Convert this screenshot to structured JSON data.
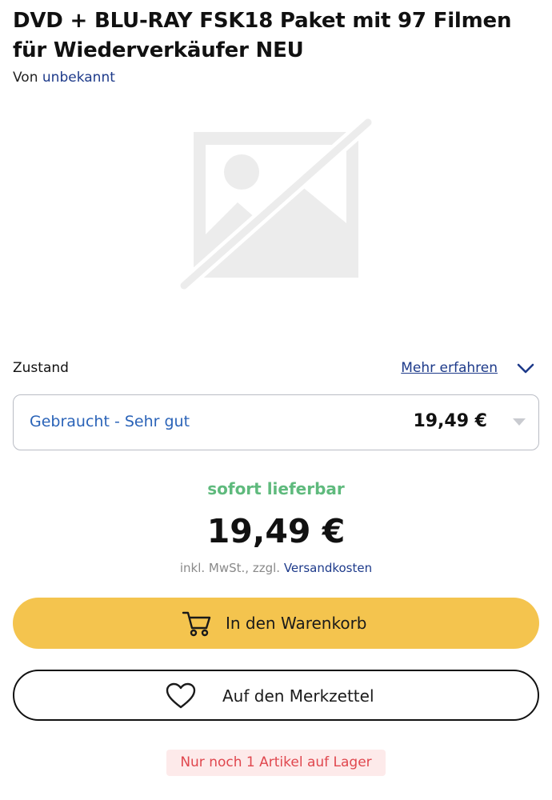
{
  "product": {
    "title": "DVD + BLU-RAY FSK18 Paket mit 97 Filmen für Wiederverkäufer NEU",
    "by_prefix": "Von",
    "by_name": "unbekannt",
    "image_icon": "image-placeholder-icon"
  },
  "condition": {
    "label": "Zustand",
    "more_link": "Mehr erfahren",
    "selected": "Gebraucht - Sehr gut",
    "price": "19,49 €"
  },
  "offer": {
    "availability": "sofort lieferbar",
    "price": "19,49 €",
    "tax_prefix": "inkl. MwSt., zzgl.",
    "shipping_link": "Versandkosten"
  },
  "actions": {
    "add_to_cart": "In den Warenkorb",
    "add_to_wishlist": "Auf den Merkzettel"
  },
  "stock": {
    "message": "Nur noch 1 Artikel auf Lager"
  },
  "colors": {
    "accent_button": "#f4c44e",
    "link": "#1d3a8a",
    "condition_text": "#2a63b8",
    "available": "#5fba7d",
    "stock_warning": "#e0474e"
  }
}
